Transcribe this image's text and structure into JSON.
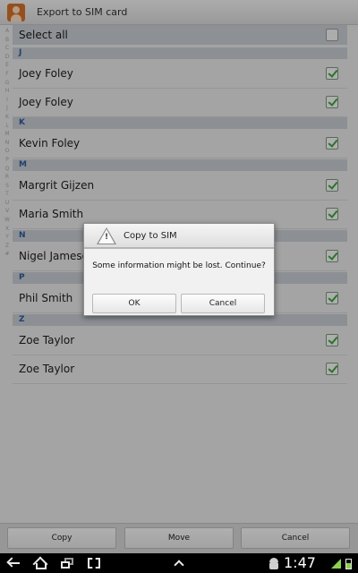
{
  "titlebar": {
    "title": "Export to SIM card"
  },
  "index_letters": [
    "A",
    "B",
    "C",
    "D",
    "E",
    "F",
    "G",
    "H",
    "I",
    "J",
    "K",
    "L",
    "M",
    "N",
    "O",
    "P",
    "Q",
    "R",
    "S",
    "T",
    "U",
    "V",
    "W",
    "X",
    "Y",
    "Z",
    "#"
  ],
  "select_all": {
    "label": "Select all",
    "checked": false
  },
  "sections": [
    {
      "letter": "J",
      "contacts": [
        {
          "name": "Joey Foley",
          "checked": true
        },
        {
          "name": "Joey Foley",
          "checked": true
        }
      ]
    },
    {
      "letter": "K",
      "contacts": [
        {
          "name": "Kevin Foley",
          "checked": true
        }
      ]
    },
    {
      "letter": "M",
      "contacts": [
        {
          "name": "Margrit Gijzen",
          "checked": true
        },
        {
          "name": "Maria Smith",
          "checked": true
        }
      ]
    },
    {
      "letter": "N",
      "contacts": [
        {
          "name": "Nigel Jameson",
          "checked": true
        }
      ]
    },
    {
      "letter": "P",
      "contacts": [
        {
          "name": "Phil Smith",
          "checked": true
        }
      ]
    },
    {
      "letter": "Z",
      "contacts": [
        {
          "name": "Zoe Taylor",
          "checked": true
        },
        {
          "name": "Zoe Taylor",
          "checked": true
        }
      ]
    }
  ],
  "bottom_bar": {
    "copy_label": "Copy",
    "move_label": "Move",
    "cancel_label": "Cancel"
  },
  "dialog": {
    "title": "Copy to SIM",
    "icon": "warning-icon",
    "message": "Some information might be lost. Continue?",
    "ok_label": "OK",
    "cancel_label": "Cancel"
  },
  "statusbar": {
    "time": "1:47",
    "battery_level": 0.6
  },
  "colors": {
    "check_green": "#3da53d",
    "section_letter": "#2f5c9e",
    "signal_green": "#8fd14f"
  }
}
